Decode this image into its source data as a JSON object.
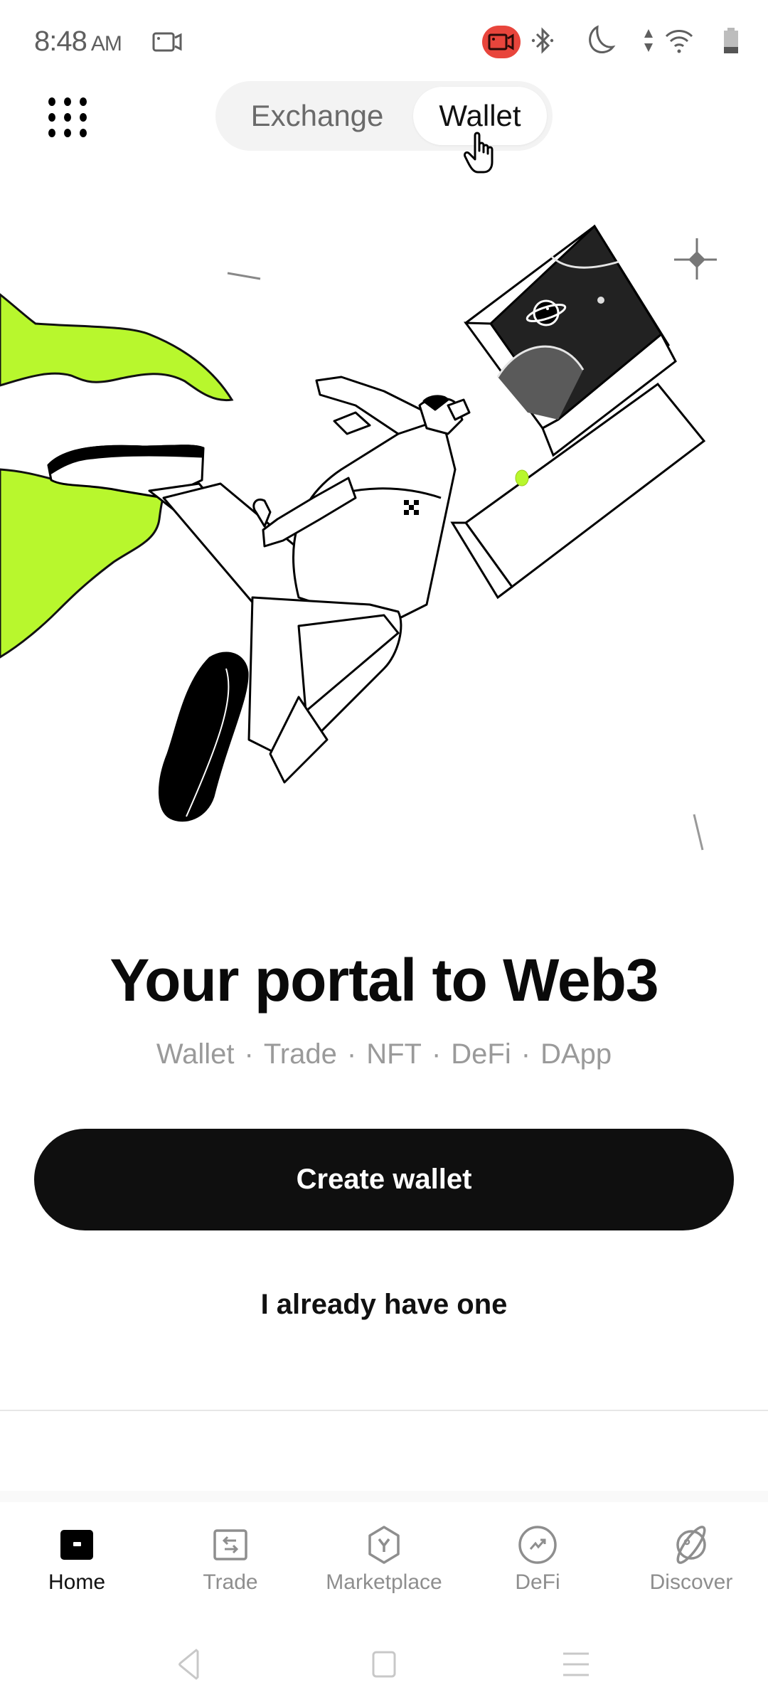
{
  "status_bar": {
    "time": "8:48",
    "ampm": "AM",
    "icons": [
      "screen-record-icon",
      "recording-active-icon",
      "bluetooth-icon",
      "do-not-disturb-moon-icon",
      "data-arrows-icon",
      "wifi-icon",
      "battery-icon"
    ],
    "record_color": "#e8453c"
  },
  "header": {
    "menu_icon": "grid-dots-icon",
    "tabs": [
      {
        "label": "Exchange",
        "active": false
      },
      {
        "label": "Wallet",
        "active": true
      }
    ]
  },
  "hero": {
    "illustration": "astronaut-portal-illustration",
    "accent_color": "#b8f72d"
  },
  "main": {
    "headline": "Your portal to Web3",
    "tagline_items": [
      "Wallet",
      "Trade",
      "NFT",
      "DeFi",
      "DApp"
    ],
    "tagline_separator": "·",
    "primary_button": "Create wallet",
    "secondary_link": "I already have one"
  },
  "bottom_nav": {
    "items": [
      {
        "label": "Home",
        "icon": "wallet-home-icon",
        "active": true
      },
      {
        "label": "Trade",
        "icon": "swap-arrows-icon",
        "active": false
      },
      {
        "label": "Marketplace",
        "icon": "hexagon-y-icon",
        "active": false
      },
      {
        "label": "DeFi",
        "icon": "trend-chart-icon",
        "active": false
      },
      {
        "label": "Discover",
        "icon": "planet-icon",
        "active": false
      }
    ]
  },
  "system_nav": {
    "buttons": [
      "back",
      "home",
      "recents"
    ]
  }
}
